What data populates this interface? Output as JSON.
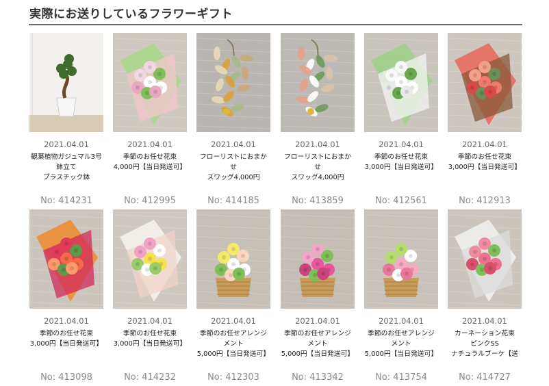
{
  "page": {
    "title": "実際にお送りしているフラワーギフト"
  },
  "rows": [
    [
      {
        "date": "2021.04.01",
        "name": "観葉植物ガジュマル3号\n鉢立て\nプラスチック鉢",
        "no": "No: 414231",
        "photo": "bonsai"
      },
      {
        "date": "2021.04.01",
        "name": "季節のお任せ花束\n4,000円【当日発送可】",
        "no": "No: 412995",
        "photo": "bouquet-green"
      },
      {
        "date": "2021.04.01",
        "name": "フローリストにおまか\nせ\nスワッグ4,000円",
        "no": "No: 414185",
        "photo": "swag-dry"
      },
      {
        "date": "2021.04.01",
        "name": "フローリストにおまか\nせ\nスワッグ4,000円",
        "no": "No: 413859",
        "photo": "swag-green"
      },
      {
        "date": "2021.04.01",
        "name": "季節のお任せ花束\n3,000円【当日発送可】",
        "no": "No: 412561",
        "photo": "bouquet-white"
      },
      {
        "date": "2021.04.01",
        "name": "季節のお任せ花束\n3,000円【当日発送可】",
        "no": "No: 412913",
        "photo": "bouquet-red"
      }
    ],
    [
      {
        "date": "2021.04.01",
        "name": "季節のお任せ花束\n3,000円【当日発送可】",
        "no": "No: 413098",
        "photo": "bouquet-orange"
      },
      {
        "date": "2021.04.01",
        "name": "季節のお任せ花束\n3,000円【当日発送可】",
        "no": "No: 414232",
        "photo": "bouquet-yellow"
      },
      {
        "date": "2021.04.01",
        "name": "季節のお任せアレンジ\nメント\n5,000円【当日発送可】",
        "no": "No: 412303",
        "photo": "arrange-white"
      },
      {
        "date": "2021.04.01",
        "name": "季節のお任せアレンジ\nメント\n5,000円【当日発送可】",
        "no": "No: 413342",
        "photo": "arrange-pink"
      },
      {
        "date": "2021.04.01",
        "name": "季節のお任せアレンジ\nメント\n5,000円【当日発送可】",
        "no": "No: 413754",
        "photo": "arrange-mixed"
      },
      {
        "date": "2021.04.01",
        "name": "カーネーション花束\nピンクSS\nナチュラルブーケ【送",
        "no": "No: 414727",
        "photo": "carnation"
      }
    ]
  ],
  "colors": {
    "heading_rule": "#6a6a6a",
    "number_text": "#8a8a8a"
  }
}
